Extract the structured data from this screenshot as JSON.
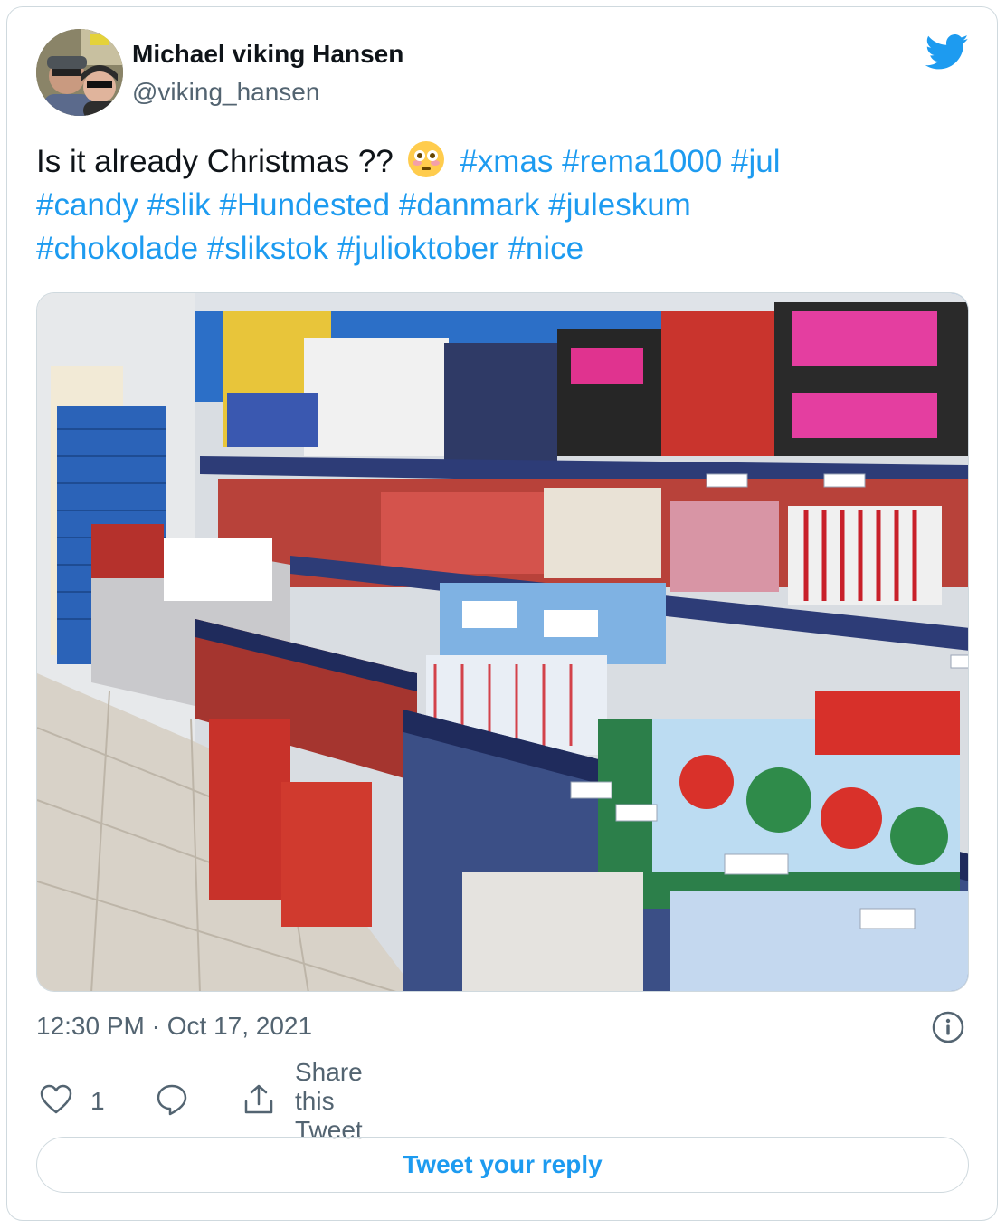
{
  "author": {
    "name": "Michael viking Hansen",
    "handle": "@viking_hansen"
  },
  "tweet": {
    "text_lead": "Is it already Christmas ??",
    "emoji": "flushed-face",
    "hashtags_line1": [
      "#xmas",
      "#rema1000",
      "#jul"
    ],
    "hashtags_line2": [
      "#candy",
      "#slik",
      "#Hundested",
      "#danmark",
      "#juleskum"
    ],
    "hashtags_line3": [
      "#chokolade",
      "#slikstok",
      "#julioktober",
      "#nice"
    ]
  },
  "timestamp": "12:30 PM · Oct 17, 2021",
  "actions": {
    "like_count": "1",
    "share_label": "Share this Tweet"
  },
  "reply_button": "Tweet your reply",
  "colors": {
    "accent": "#1d9bf0",
    "secondary_text": "#536471",
    "border": "#cfd9de"
  },
  "icons": [
    "twitter-bird-icon",
    "info-icon",
    "heart-icon",
    "reply-bubble-icon",
    "share-icon"
  ]
}
